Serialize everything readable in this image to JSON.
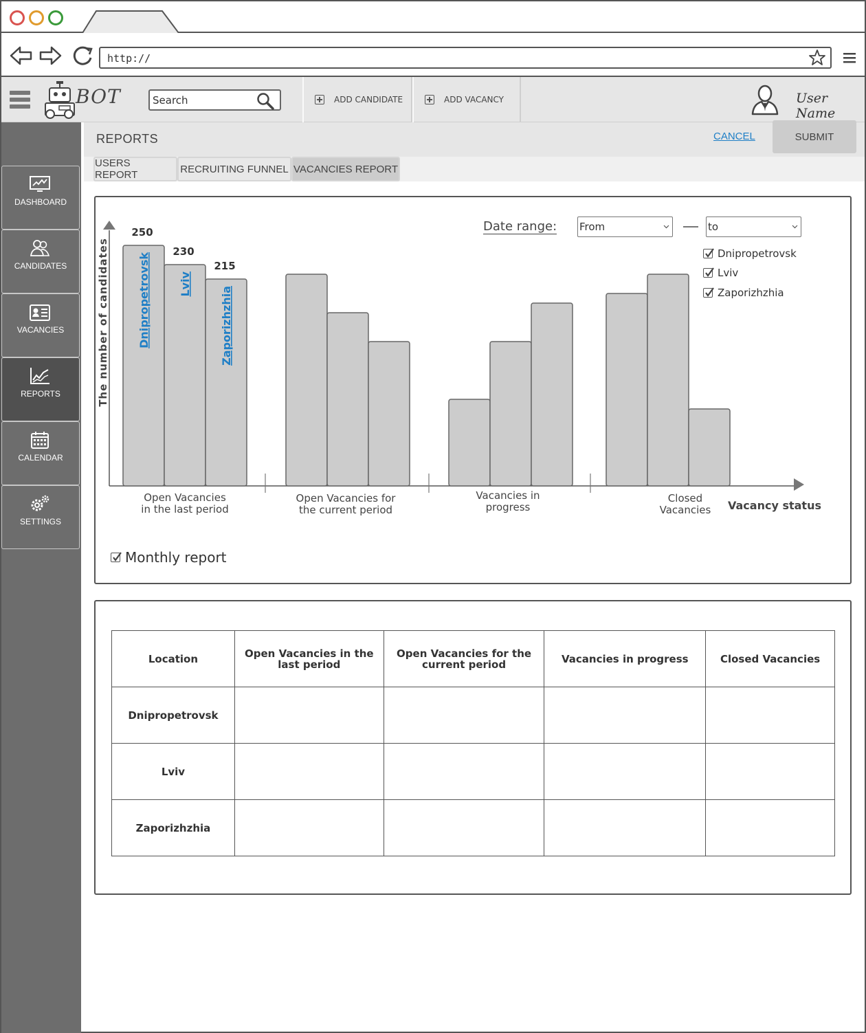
{
  "browser": {
    "url": "http://"
  },
  "header": {
    "logo_text": "BOT",
    "search_placeholder": "Search",
    "add_candidate": "ADD CANDIDATE",
    "add_vacancy": "ADD VACANCY",
    "user_name": "User Name"
  },
  "sidebar": {
    "items": [
      {
        "label": "DASHBOARD",
        "icon": "dashboard-icon"
      },
      {
        "label": "CANDIDATES",
        "icon": "candidates-icon"
      },
      {
        "label": "VACANCIES",
        "icon": "vacancies-icon"
      },
      {
        "label": "REPORTS",
        "icon": "reports-icon",
        "active": true
      },
      {
        "label": "CALENDAR",
        "icon": "calendar-icon"
      },
      {
        "label": "SETTINGS",
        "icon": "settings-icon"
      }
    ]
  },
  "page": {
    "title": "REPORTS",
    "cancel": "CANCEL",
    "submit": "SUBMIT",
    "tabs": [
      "USERS REPORT",
      "RECRUITING FUNNEL",
      "VACANCIES REPORT"
    ],
    "active_tab": "VACANCIES REPORT"
  },
  "filters": {
    "date_range_label": "Date range:",
    "from": "From",
    "to": "to",
    "locations": [
      {
        "label": "Dnipropetrovsk",
        "checked": true
      },
      {
        "label": "Lviv",
        "checked": true
      },
      {
        "label": "Zaporizhzhia",
        "checked": true
      }
    ],
    "monthly_report": {
      "label": "Monthly report",
      "checked": true
    }
  },
  "chart_data": {
    "type": "bar",
    "ylabel": "The number of candidates",
    "xlabel": "Vacancy status",
    "categories": [
      "Open Vacancies\nin the last period",
      "Open Vacancies for\nthe current period",
      "Vacancies in\nprogress",
      "Closed\nVacancies"
    ],
    "series": [
      {
        "name": "Dnipropetrovsk",
        "values": [
          250,
          220,
          90,
          200
        ]
      },
      {
        "name": "Lviv",
        "values": [
          230,
          180,
          150,
          220
        ]
      },
      {
        "name": "Zaporizhzhia",
        "values": [
          215,
          150,
          190,
          80
        ]
      }
    ],
    "data_labels": [
      "250",
      "230",
      "215"
    ],
    "ylim": [
      0,
      270
    ],
    "label_color": "#1f7fc6",
    "bar_color": "#cccccc"
  },
  "table": {
    "headers": [
      "Location",
      "Open Vacancies in the last period",
      "Open Vacancies for the current period",
      "Vacancies in progress",
      "Closed Vacancies"
    ],
    "rows": [
      [
        "Dnipropetrovsk",
        "",
        "",
        "",
        ""
      ],
      [
        "Lviv",
        "",
        "",
        "",
        ""
      ],
      [
        "Zaporizhzhia",
        "",
        "",
        "",
        ""
      ]
    ]
  }
}
